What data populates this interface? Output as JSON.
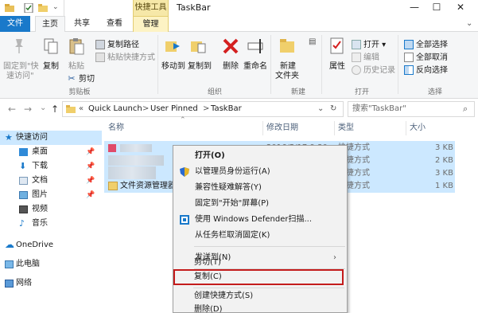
{
  "window": {
    "title": "TaskBar",
    "controls": {
      "minimize": "—",
      "maximize": "☐",
      "close": "✕"
    }
  },
  "ribbon": {
    "contextual_group": "快捷工具",
    "tabs": [
      {
        "label": "文件"
      },
      {
        "label": "主页"
      },
      {
        "label": "共享"
      },
      {
        "label": "查看"
      },
      {
        "label": "管理"
      }
    ],
    "groups": {
      "clipboard": {
        "label": "剪贴板",
        "pin_quick_access": "固定到\"快",
        "pin_quick_access_2": "速访问\"",
        "copy": "复制",
        "paste": "粘贴",
        "copy_path": "复制路径",
        "paste_shortcut": "粘贴快捷方式",
        "cut": "剪切"
      },
      "organize": {
        "label": "组织",
        "move_to": "移动到",
        "copy_to": "复制到",
        "delete": "删除",
        "rename": "重命名"
      },
      "new": {
        "label": "新建",
        "new_folder": "新建",
        "new_folder_2": "文件夹"
      },
      "open": {
        "label": "打开",
        "properties": "属性",
        "open": "打开 ▾",
        "edit": "编辑",
        "history": "历史记录"
      },
      "select": {
        "label": "选择",
        "select_all": "全部选择",
        "select_none": "全部取消",
        "invert": "反向选择"
      }
    }
  },
  "navigation": {
    "back": "←",
    "forward": "→",
    "recent": "⌄",
    "up": "↑",
    "breadcrumb_overflow": "«",
    "breadcrumb": [
      "Quick Launch",
      "User Pinned",
      "TaskBar"
    ],
    "breadcrumb_sep": ">",
    "search_placeholder": "搜索\"TaskBar\""
  },
  "nav_pane": {
    "items": [
      {
        "label": "快速访问"
      },
      {
        "label": "桌面"
      },
      {
        "label": "下载"
      },
      {
        "label": "文档"
      },
      {
        "label": "图片"
      },
      {
        "label": "视频"
      },
      {
        "label": "音乐"
      },
      {
        "label": "OneDrive"
      },
      {
        "label": "此电脑"
      },
      {
        "label": "网络"
      }
    ]
  },
  "file_list": {
    "columns": {
      "name": "名称",
      "date": "修改日期",
      "type": "类型",
      "size": "大小"
    },
    "rows": [
      {
        "name": "",
        "date": "2016/5/17 9:30",
        "type": "快捷方式",
        "size": "3 KB"
      },
      {
        "name": "",
        "date": "",
        "type": "快捷方式",
        "size": "2 KB"
      },
      {
        "name": "",
        "date": "",
        "type": "快捷方式",
        "size": "3 KB"
      },
      {
        "name": "文件资源管理器",
        "date": "",
        "type": "快捷方式",
        "size": "1 KB"
      }
    ]
  },
  "context_menu": {
    "items": [
      {
        "label": "打开(O)"
      },
      {
        "label": "以管理员身份运行(A)"
      },
      {
        "label": "兼容性疑难解答(Y)"
      },
      {
        "label": "固定到\"开始\"屏幕(P)"
      },
      {
        "label": "使用 Windows Defender扫描..."
      },
      {
        "label": "从任务栏取消固定(K)"
      },
      {
        "label": "发送到(N)"
      },
      {
        "label": "剪切(T)"
      },
      {
        "label": "复制(C)"
      },
      {
        "label": "创建快捷方式(S)"
      },
      {
        "label": "删除(D)"
      }
    ],
    "highlight_color": "#c41c1c"
  },
  "colors": {
    "accent": "#1979ca",
    "selection": "#cce8ff",
    "contextual_tab": "#f6e8a8"
  }
}
